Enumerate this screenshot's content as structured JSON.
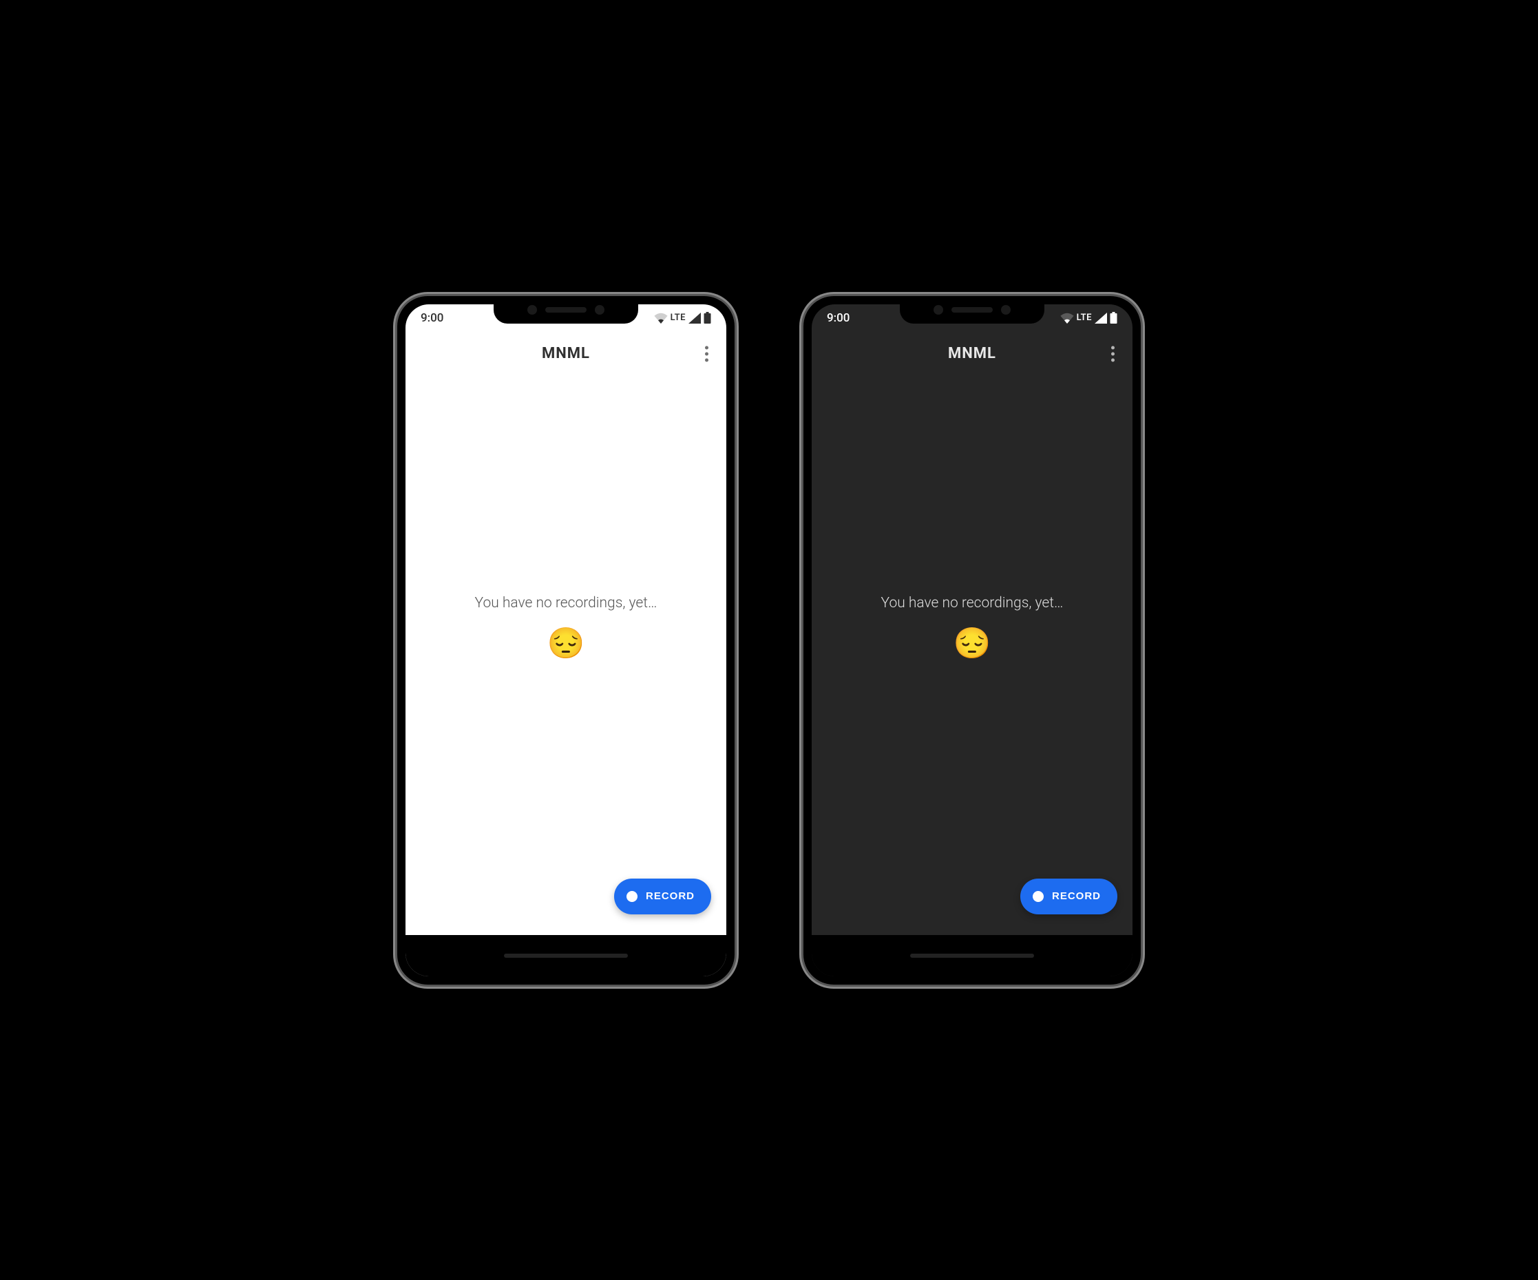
{
  "status": {
    "time": "9:00",
    "network_label": "LTE"
  },
  "app": {
    "title": "MNML"
  },
  "empty_state": {
    "message": "You have no recordings, yet…",
    "emoji": "😔"
  },
  "fab": {
    "label": "RECORD"
  },
  "screens": [
    {
      "theme": "light"
    },
    {
      "theme": "dark"
    }
  ],
  "colors": {
    "accent": "#1d6cf0",
    "light_bg": "#ffffff",
    "dark_bg": "#262626"
  }
}
